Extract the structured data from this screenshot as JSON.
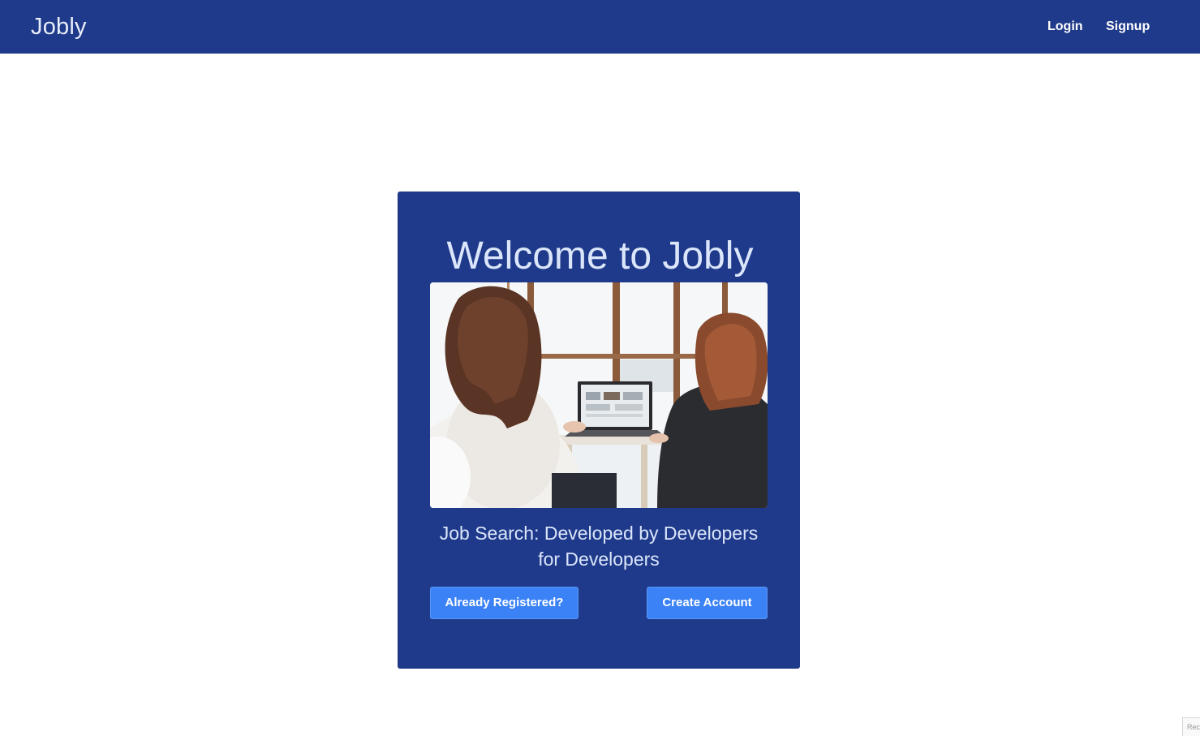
{
  "navbar": {
    "brand": "Jobly",
    "links": [
      {
        "label": "Login"
      },
      {
        "label": "Signup"
      }
    ]
  },
  "card": {
    "title": "Welcome to Jobly",
    "image_alt": "two-people-at-laptop-photo",
    "tagline": "Job Search: Developed by Developers for Developers",
    "buttons": {
      "login_label": "Already Registered?",
      "signup_label": "Create Account"
    }
  },
  "corner_widget": {
    "label": "Rec"
  },
  "colors": {
    "primary": "#1f3a8a",
    "button": "#3b82f6",
    "title_text": "#dbe6fb",
    "background": "#ffffff"
  }
}
